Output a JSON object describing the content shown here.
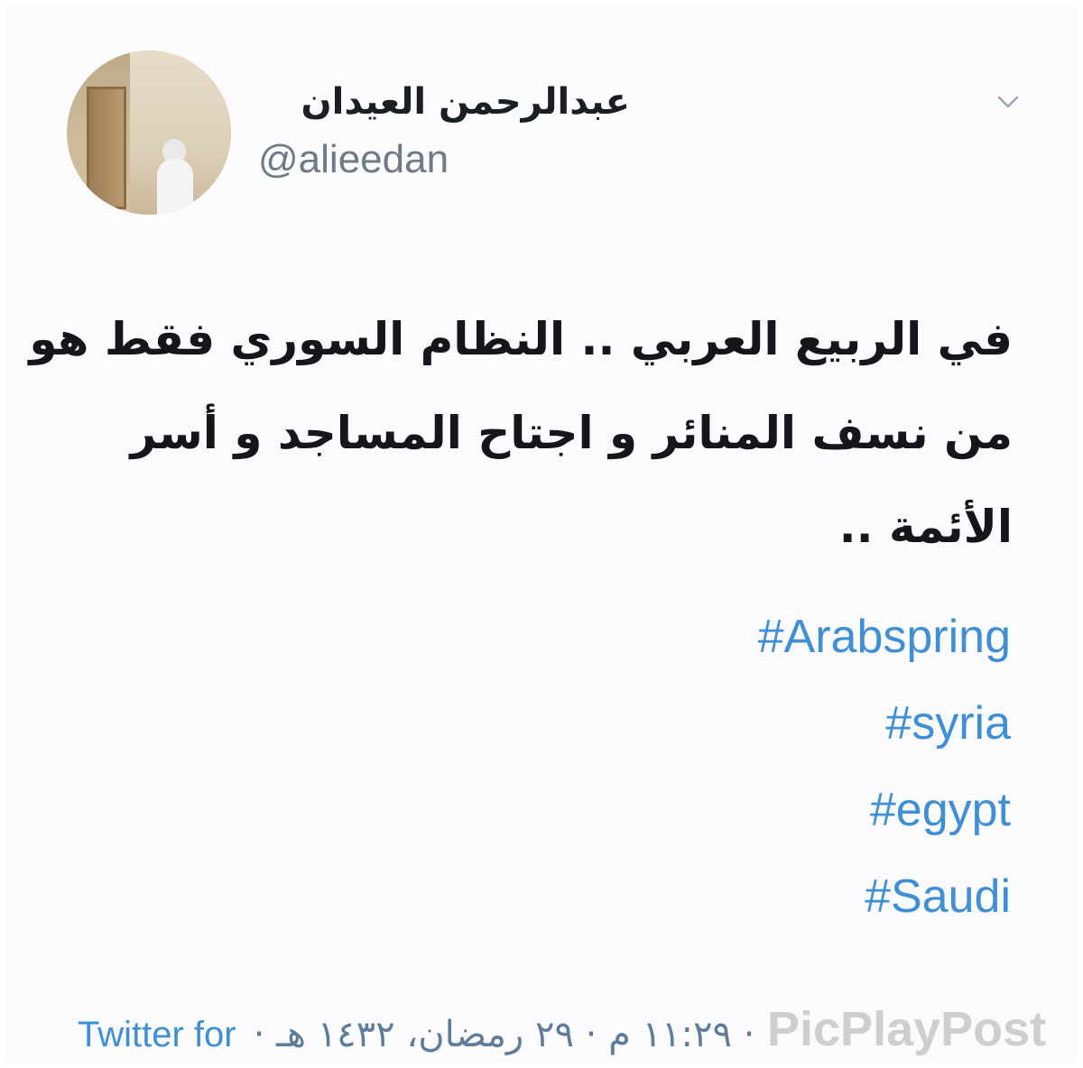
{
  "tweet": {
    "author": {
      "display_name": "عبدالرحمن العيدان",
      "handle": "@alieedan"
    },
    "text_lines": [
      "في الربيع العربي .. النظام السوري فقط هو",
      "من نسف المنائر و اجتاح المساجد و أسر",
      "الأئمة .."
    ],
    "hashtags": [
      "#Arabspring",
      "#syria",
      "#egypt",
      "#Saudi"
    ],
    "footer": {
      "source_label": "Twitter for",
      "timestamp": "· ١١:٢٩ م · ٢٩ رمضان، ١٤٣٢ هـ ·"
    },
    "more_icon": "chevron-down-icon"
  },
  "watermark": {
    "text": "PicPlayPost"
  },
  "colors": {
    "link": "#3e8fd6",
    "text": "#141619",
    "muted": "#6e7a86"
  }
}
